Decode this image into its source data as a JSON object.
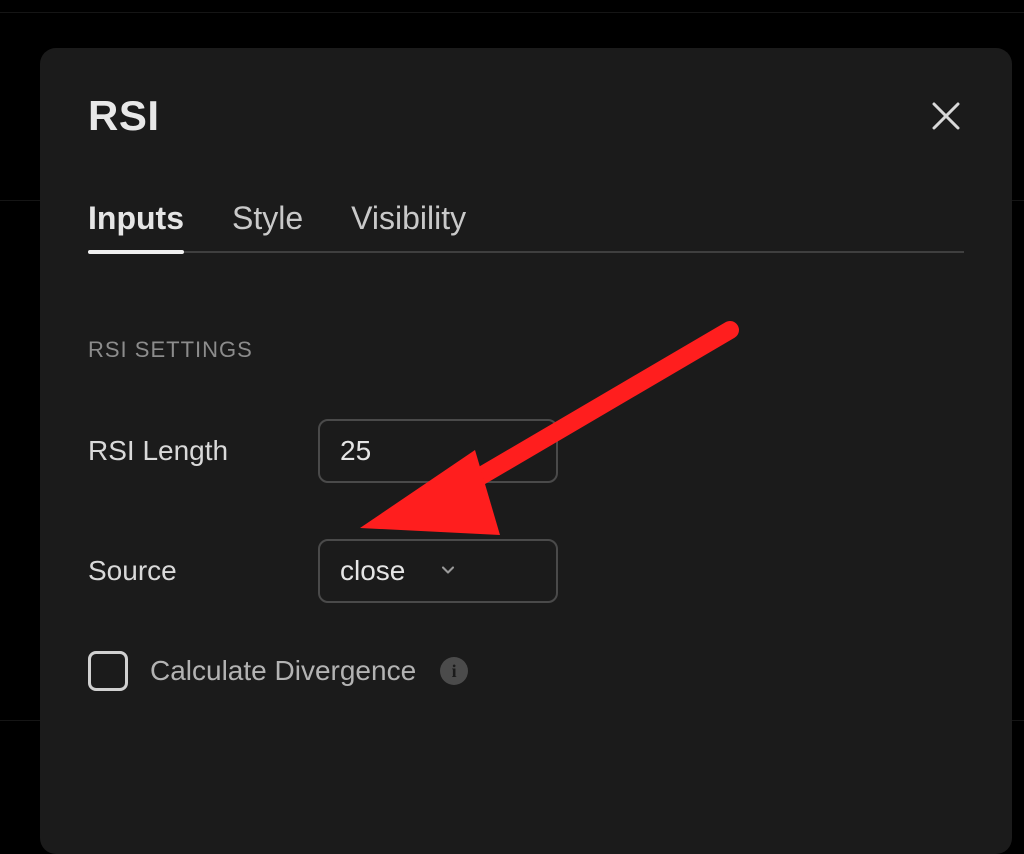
{
  "panel": {
    "title": "RSI"
  },
  "tabs": {
    "active": "Inputs",
    "items": [
      "Inputs",
      "Style",
      "Visibility"
    ]
  },
  "section": {
    "title": "RSI SETTINGS"
  },
  "fields": {
    "rsi_length_label": "RSI Length",
    "rsi_length_value": "25",
    "source_label": "Source",
    "source_value": "close",
    "calc_divergence_label": "Calculate Divergence",
    "calc_divergence_checked": false
  },
  "annotation": {
    "color": "#ff1e1e"
  }
}
